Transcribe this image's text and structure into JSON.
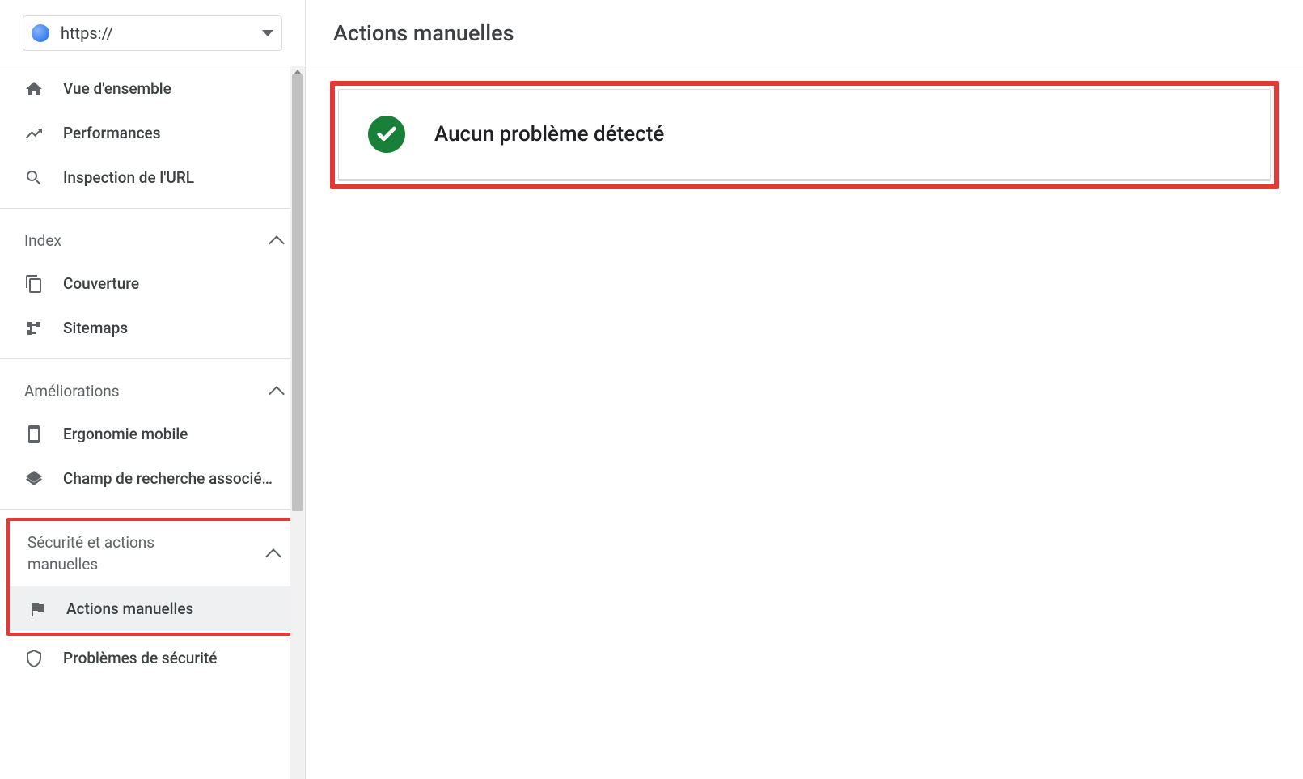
{
  "property": {
    "url": "https://"
  },
  "nav": {
    "overview": "Vue d'ensemble",
    "performance": "Performances",
    "url_inspection": "Inspection de l'URL"
  },
  "sections": {
    "index": {
      "title": "Index",
      "items": {
        "coverage": "Couverture",
        "sitemaps": "Sitemaps"
      }
    },
    "enhancements": {
      "title": "Améliorations",
      "items": {
        "mobile": "Ergonomie mobile",
        "searchbox": "Champ de recherche associé…"
      }
    },
    "security": {
      "title": "Sécurité et actions manuelles",
      "items": {
        "manual_actions": "Actions manuelles",
        "security_issues": "Problèmes de sécurité"
      }
    }
  },
  "main": {
    "title": "Actions manuelles",
    "status_message": "Aucun problème détecté"
  }
}
